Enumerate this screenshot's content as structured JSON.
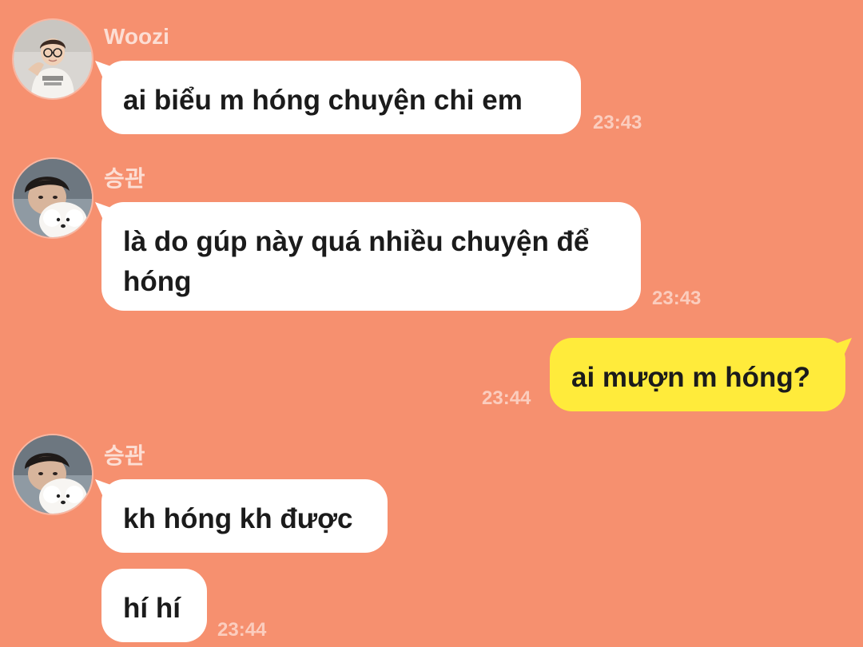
{
  "colors": {
    "background": "#f6906f",
    "incoming_bubble": "#ffffff",
    "outgoing_bubble": "#ffeb3b",
    "meta_text": "#ffffff"
  },
  "messages": [
    {
      "sender": "Woozi",
      "text": "ai biểu m hóng chuyện chi em",
      "time": "23:43",
      "direction": "incoming",
      "avatar_icon": "profile-photo-woozi"
    },
    {
      "sender": "승관",
      "text": "là do gúp này quá nhiều chuyện để hóng",
      "time": "23:43",
      "direction": "incoming",
      "avatar_icon": "profile-photo-with-white-dog"
    },
    {
      "text": "ai mượn m hóng?",
      "time": "23:44",
      "direction": "outgoing"
    },
    {
      "sender": "승관",
      "text": "kh hóng kh được",
      "direction": "incoming",
      "avatar_icon": "profile-photo-with-white-dog"
    },
    {
      "text": "hí hí",
      "time": "23:44",
      "direction": "incoming"
    }
  ]
}
